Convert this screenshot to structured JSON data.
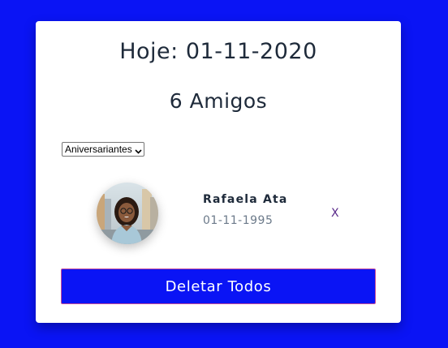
{
  "header": {
    "today": "Hoje: 01-11-2020",
    "friend_count": "6 Amigos"
  },
  "filter": {
    "selected": "Aniversariantes"
  },
  "friends": [
    {
      "name": "Rafaela Ata",
      "birthdate": "01-11-1995",
      "remove_label": "X"
    }
  ],
  "actions": {
    "delete_all_label": "Deletar Todos"
  },
  "colors": {
    "background": "#0a14f5",
    "card": "#ffffff",
    "button": "#0a14f5",
    "text_dark": "#1e2a3a",
    "text_muted": "#6c7a8a",
    "remove": "#5a2a8a"
  },
  "icons": {
    "select_chevron": "chevron-down-icon",
    "avatar": "avatar-photo"
  }
}
